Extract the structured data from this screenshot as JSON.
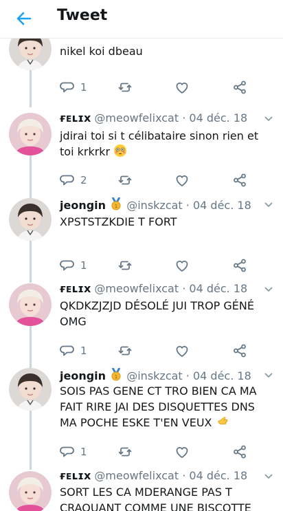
{
  "header": {
    "title": "Tweet"
  },
  "tweets": [
    {
      "name": "",
      "handle": "",
      "date": "",
      "text": "nikel koi dbeau",
      "reply_count": "1"
    },
    {
      "name": "ғᴇʟɪx",
      "handle": "@meowfelixcat",
      "date": "04 déc. 18",
      "text": "jdirai toi si t célibataire sinon rien et toi krkrkr",
      "reply_count": "2"
    },
    {
      "name": "jeongin",
      "handle": "@inskzcat",
      "date": "04 déc. 18",
      "text": "XPSTSTZKDIE T FORT",
      "reply_count": "1"
    },
    {
      "name": "ғᴇʟɪx",
      "handle": "@meowfelixcat",
      "date": "04 déc. 18",
      "text": "QKDKZJZJD DÉSOLÉ JUI TROP GÉNÉ OMG",
      "reply_count": "1"
    },
    {
      "name": "jeongin",
      "handle": "@inskzcat",
      "date": "04 déc. 18",
      "text": "SOIS PAS GENE CT TRO BIEN CA MA FAIT RIRE JAI DES DISQUETTES DNS MA POCHE ESKE T'EN VEUX",
      "reply_count": "1"
    },
    {
      "name": "ғᴇʟɪx",
      "handle": "@meowfelixcat",
      "date": "04 déc. 18",
      "text": "SORT LES CA MDERANGE PAS T CRAQUANT COMME UNE BISCOTTE",
      "reply_count": ""
    }
  ],
  "separator": "·",
  "icons": [
    "back-arrow-icon",
    "reply-icon",
    "retweet-icon",
    "like-icon",
    "share-icon",
    "chevron-down-icon",
    "medal-icon",
    "flushed-face-emoji",
    "hand-emoji"
  ],
  "colors": {
    "accent": "#1da1f2",
    "text": "#14171a",
    "muted": "#657786",
    "thread": "#ccd6dd"
  }
}
